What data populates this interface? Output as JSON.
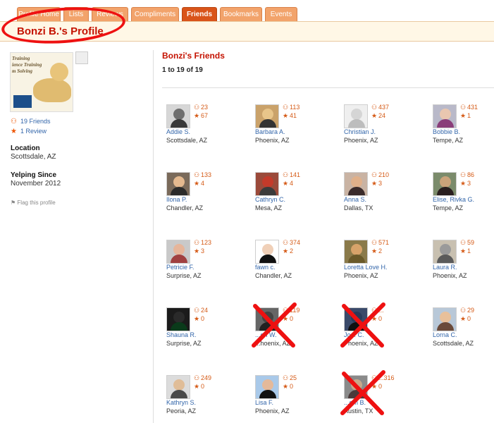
{
  "tabs": [
    {
      "label": "Profile Home"
    },
    {
      "label": "Lists"
    },
    {
      "label": "Reviews"
    },
    {
      "label": "Compliments"
    },
    {
      "label": "Friends"
    },
    {
      "label": "Bookmarks"
    },
    {
      "label": "Events"
    }
  ],
  "profile": {
    "title": "Bonzi B.'s Profile"
  },
  "sidebar": {
    "image_lines": [
      "Training",
      "ience Training",
      "m Solving"
    ],
    "friends_link": "19 Friends",
    "reviews_link": "1 Review",
    "location_label": "Location",
    "location_value": "Scottsdale, AZ",
    "since_label": "Yelping Since",
    "since_value": "November 2012",
    "flag_label": "Flag this profile"
  },
  "friends_section": {
    "heading": "Bonzi's Friends",
    "count": "1 to 19 of 19"
  },
  "icons": {
    "friends": "friends-icon",
    "reviews": "star-icon",
    "flag": "flag-icon"
  },
  "colors": {
    "accent": "#c41200",
    "tab": "#f2a36b",
    "tab_active": "#d9541a",
    "link": "#3366aa",
    "crossout": "#ee1111"
  },
  "friends": [
    {
      "name": "Addie S.",
      "location": "Scottsdale, AZ",
      "friends": "23",
      "reviews": "67"
    },
    {
      "name": "Barbara A.",
      "location": "Phoenix, AZ",
      "friends": "113",
      "reviews": "41"
    },
    {
      "name": "Christian J.",
      "location": "Phoenix, AZ",
      "friends": "437",
      "reviews": "24"
    },
    {
      "name": "Bobbie B.",
      "location": "Tempe, AZ",
      "friends": "431",
      "reviews": "1"
    },
    {
      "name": "Ilona P.",
      "location": "Chandler, AZ",
      "friends": "133",
      "reviews": "4"
    },
    {
      "name": "Cathryn C.",
      "location": "Mesa, AZ",
      "friends": "141",
      "reviews": "4"
    },
    {
      "name": "Anna S.",
      "location": "Dallas, TX",
      "friends": "210",
      "reviews": "3"
    },
    {
      "name": "Elise, Rivka G.",
      "location": "Tempe, AZ",
      "friends": "86",
      "reviews": "3"
    },
    {
      "name": "Petricie F.",
      "location": "Surprise, AZ",
      "friends": "123",
      "reviews": "3"
    },
    {
      "name": "fawn c.",
      "location": "Chandler, AZ",
      "friends": "374",
      "reviews": "2"
    },
    {
      "name": "Loretta Love H.",
      "location": "Phoenix, AZ",
      "friends": "571",
      "reviews": "2"
    },
    {
      "name": "Laura R.",
      "location": "Phoenix, AZ",
      "friends": "59",
      "reviews": "1"
    },
    {
      "name": "Shauna R.",
      "location": "Surprise, AZ",
      "friends": "24",
      "reviews": "0"
    },
    {
      "name": "...on W.",
      "location": "...hoenix, AZ",
      "friends": "119",
      "reviews": "0",
      "crossed": true
    },
    {
      "name": "Jo... C.",
      "location": "Phoenix, AZ",
      "friends": "...",
      "reviews": "0",
      "crossed": true
    },
    {
      "name": "Lorna C.",
      "location": "Scottsdale, AZ",
      "friends": "29",
      "reviews": "0"
    },
    {
      "name": "Kathryn S.",
      "location": "Peoria, AZ",
      "friends": "249",
      "reviews": "0"
    },
    {
      "name": "Lisa F.",
      "location": "Phoenix, AZ",
      "friends": "25",
      "reviews": "0"
    },
    {
      "name": "...om B.",
      "location": "Austin, TX",
      "friends": "...316",
      "reviews": "0",
      "crossed": true
    }
  ]
}
